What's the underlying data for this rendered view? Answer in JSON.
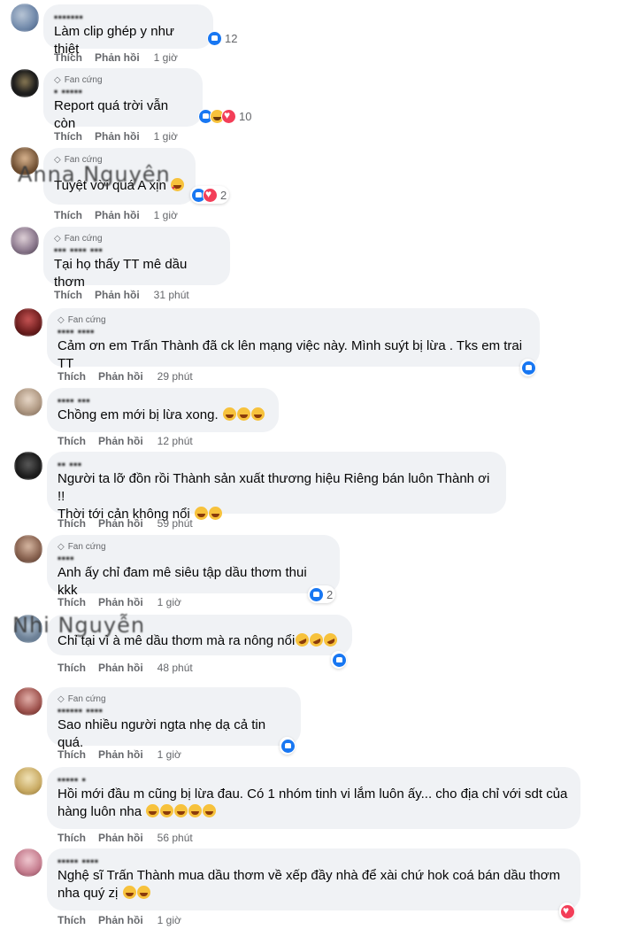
{
  "labels": {
    "like": "Thích",
    "reply": "Phản hồi",
    "fan_badge": "Fan cứng"
  },
  "comments": [
    {
      "author": "▪▪▪▪▪▪▪",
      "text": "Làm clip ghép y như thiệt",
      "reactions": [
        "like"
      ],
      "count": "12",
      "time": "1 giờ"
    },
    {
      "author": "▪ ▪▪▪▪▪",
      "badge": true,
      "text": "Report quá trời vẫn còn",
      "reactions": [
        "like",
        "haha",
        "love"
      ],
      "count": "10",
      "time": "1 giờ"
    },
    {
      "author": "Anna Nguyên",
      "badge": true,
      "text": "Tuyệt vời quá A xịn",
      "reactions": [
        "like",
        "love"
      ],
      "count": "2",
      "time": "1 giờ"
    },
    {
      "author": "▪▪▪ ▪▪▪▪ ▪▪▪",
      "badge": true,
      "text": "Tại họ thấy TT mê dầu thơm",
      "time": "31 phút"
    },
    {
      "author": "▪▪▪▪ ▪▪▪▪",
      "badge": true,
      "text": "Cảm ơn em Trấn Thành đã ck lên mạng việc này. Mình suýt bị lừa . Tks em trai TT",
      "reactions": [
        "like"
      ],
      "time": "29 phút"
    },
    {
      "author": "▪▪▪▪ ▪▪▪",
      "text": "Chồng em mới bị lừa xong.",
      "time": "12 phút"
    },
    {
      "author": "▪▪ ▪▪▪",
      "text": "Người ta lỡ đồn rồi Thành sản xuất thương hiệu Riêng bán luôn Thành ơi !!",
      "text2": "Thời tới cản không nổi",
      "time": "59 phút"
    },
    {
      "author": "▪▪▪▪",
      "badge": true,
      "text": "Anh ấy chỉ đam mê siêu tập dầu thơm thui kkk",
      "reactions": [
        "like"
      ],
      "count": "2",
      "time": "1 giờ"
    },
    {
      "author": "Nhi Nguyễn",
      "text": "Chỉ tại vì à mê dầu thơm mà ra nông nổi",
      "reactions": [
        "like"
      ],
      "time": "48 phút"
    },
    {
      "author": "▪▪▪▪▪▪ ▪▪▪▪",
      "badge": true,
      "text": "Sao nhiều người ngta nhẹ dạ cả tin quá.",
      "reactions": [
        "like"
      ],
      "time": "1 giờ"
    },
    {
      "author": "▪▪▪▪▪ ▪",
      "text": "Hồi mới đầu m cũng bị lừa đau. Có 1 nhóm tinh vi lắm luôn ấy... cho địa chỉ với sdt của",
      "text2": "hàng luôn nha",
      "time": "56 phút"
    },
    {
      "author": "▪▪▪▪▪ ▪▪▪▪",
      "text": "Nghệ sĩ Trấn Thành mua dầu thơm về xếp đầy nhà để xài chứ hok coá bán dầu thơm",
      "text2": "nha quý zị",
      "reactions": [
        "love"
      ],
      "time": "1 giờ"
    }
  ]
}
